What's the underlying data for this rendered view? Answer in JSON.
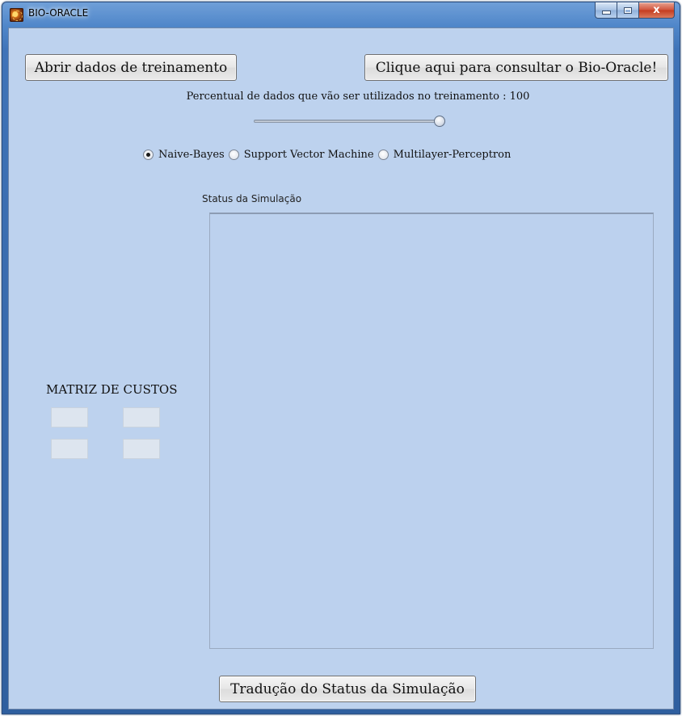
{
  "window": {
    "title": "BIO-ORACLE",
    "controls": {
      "minimize_icon": "minimize-icon",
      "maximize_icon": "maximize-icon",
      "close_label": "x"
    }
  },
  "buttons": {
    "open_training": "Abrir dados de treinamento",
    "consult": "Clique aqui para consultar o Bio-Oracle!",
    "translate_status": "Tradução do Status da Simulação"
  },
  "training": {
    "percent_label": "Percentual de dados que vão ser utilizados no treinamento : 100",
    "slider_value_percent": 100
  },
  "algorithms": {
    "options": [
      "Naive-Bayes",
      "Support Vector Machine",
      "Multilayer-Perceptron"
    ],
    "selected": "Naive-Bayes"
  },
  "status": {
    "label": "Status da Simulação",
    "text": ""
  },
  "cost_matrix": {
    "label": "MATRIZ DE CUSTOS",
    "cells": [
      [
        "",
        ""
      ],
      [
        "",
        ""
      ]
    ]
  },
  "colors": {
    "client_background": "#bdd2ee",
    "title_bar": "#4f86c9",
    "close_button": "#c33b1e"
  }
}
